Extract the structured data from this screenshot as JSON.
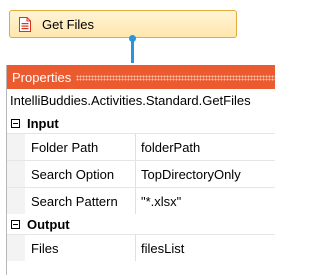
{
  "activity": {
    "label": "Get Files",
    "icon": "document-icon",
    "accent": "#e3a93c"
  },
  "panel": {
    "title": "Properties",
    "header_color": "#ec5b2f",
    "type_name": "IntelliBuddies.Activities.Standard.GetFiles"
  },
  "categories": [
    {
      "label": "Input",
      "expanded": true,
      "properties": [
        {
          "name": "Folder Path",
          "value": "folderPath"
        },
        {
          "name": "Search Option",
          "value": "TopDirectoryOnly"
        },
        {
          "name": "Search Pattern",
          "value": "\"*.xlsx\""
        }
      ]
    },
    {
      "label": "Output",
      "expanded": true,
      "properties": [
        {
          "name": "Files",
          "value": "filesList"
        }
      ]
    }
  ]
}
